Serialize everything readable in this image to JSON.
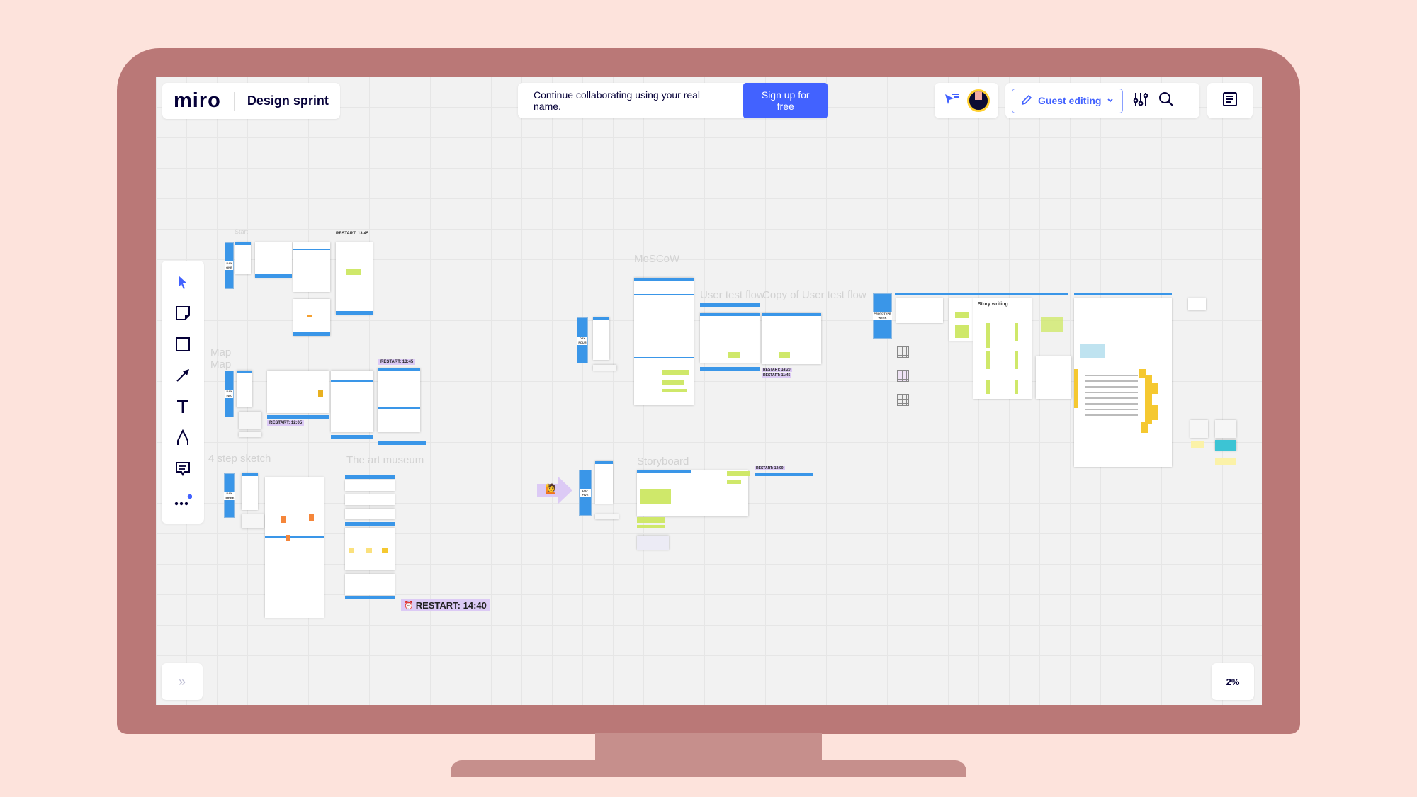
{
  "app": {
    "logo": "miro",
    "board_title": "Design sprint"
  },
  "banner": {
    "message": "Continue collaborating using your real name.",
    "signup_label": "Sign up for free"
  },
  "header": {
    "guest_editing_label": "Guest editing"
  },
  "toolbar": {
    "tools": [
      "select-icon",
      "sticky-note-icon",
      "shape-icon",
      "arrow-icon",
      "text-icon",
      "pen-icon",
      "comment-icon",
      "more-icon"
    ]
  },
  "footer": {
    "collapse_glyph": "»",
    "zoom_level": "2%"
  },
  "canvas": {
    "days": [
      "DAY ONE",
      "DAY TWO",
      "DAY THREE",
      "DAY FOUR",
      "DAY FIVE",
      "PROTOTYPE WEEK"
    ],
    "frame_labels": {
      "start": "Start",
      "map1": "Map",
      "map2": "Map",
      "sketch": "4 step sketch",
      "museum": "The art museum",
      "moscow": "MoSCoW",
      "user_test": "User test flow",
      "copy_user_test": "Copy of User test flow",
      "storyboard": "Storyboard",
      "story_writing": "Story writing"
    },
    "restarts": {
      "day1": "RESTART: 13:45",
      "day2a": "RESTART: 13:45",
      "day2b": "RESTART: 12:05",
      "day3": "RESTART: 14:40",
      "day4a": "RESTART: 14:20",
      "day4b": "RESTART: 11:45",
      "day5": "RESTART: 13:00"
    },
    "alarm_glyph": "⏰",
    "emoji_glyph": "🙋"
  },
  "colors": {
    "accent": "#4262ff",
    "frame_blue": "#3a96e8",
    "monitor": "#ba7877",
    "background": "#fde3dc",
    "restart_bg": "#dccaf5"
  }
}
